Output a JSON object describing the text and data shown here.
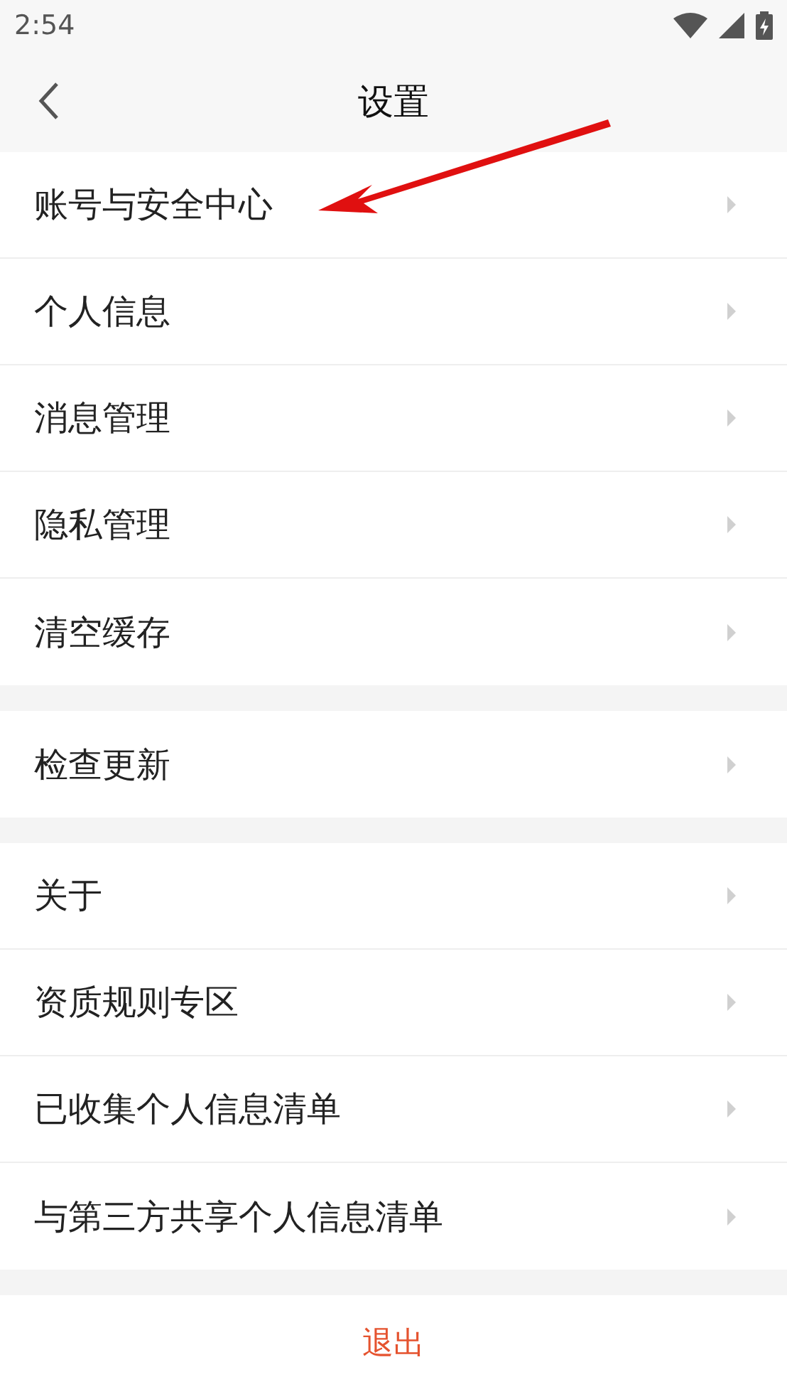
{
  "status_bar": {
    "time": "2:54"
  },
  "header": {
    "title": "设置"
  },
  "groups": [
    {
      "items": [
        "账号与安全中心",
        "个人信息",
        "消息管理",
        "隐私管理",
        "清空缓存"
      ]
    },
    {
      "items": [
        "检查更新"
      ]
    },
    {
      "items": [
        "关于",
        "资质规则专区",
        "已收集个人信息清单",
        "与第三方共享个人信息清单"
      ]
    }
  ],
  "logout": {
    "label": "退出"
  }
}
